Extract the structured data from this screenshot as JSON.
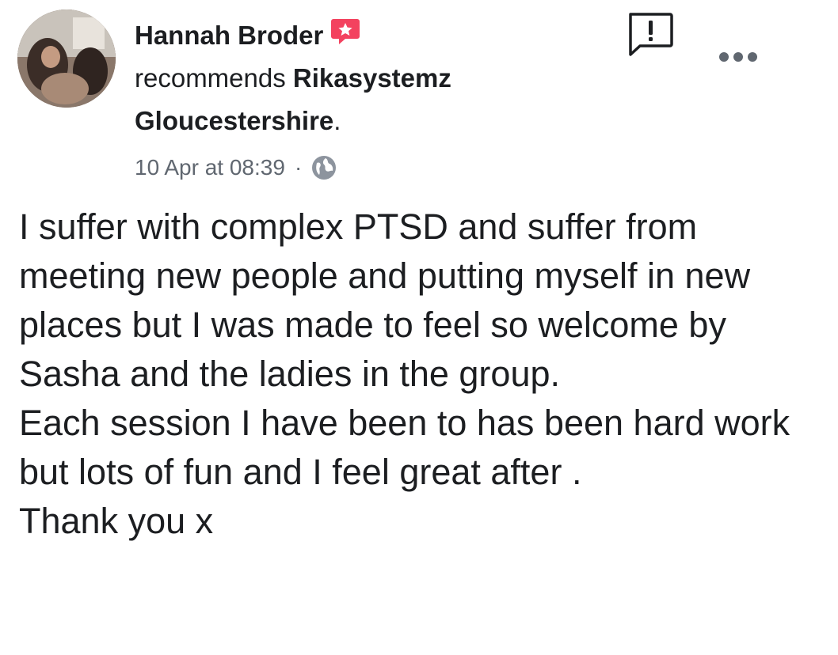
{
  "post": {
    "author_name": "Hannah Broder",
    "action_text": "recommends ",
    "page_name_line1": "Rikasystemz",
    "page_name_line2": "Gloucestershire",
    "page_name_suffix": ".",
    "timestamp": "10 Apr at 08:39",
    "separator": "·",
    "privacy_icon": "globe-icon",
    "recommendation_icon": "recommendation-star-icon",
    "report_icon": "report-exclamation-icon",
    "more_icon": "more-options-icon",
    "body_paragraphs": [
      "I suffer with complex PTSD and suffer from meeting new people and putting myself in new places but I was made to feel so welcome by Sasha and the ladies in the group.",
      "Each session I have been to has been hard work but lots of fun and I feel great after .",
      "Thank you x"
    ]
  },
  "colors": {
    "text_primary": "#1c1e21",
    "text_secondary": "#606770",
    "recommend_red": "#f3425f",
    "icon_gray": "#8d949e"
  }
}
